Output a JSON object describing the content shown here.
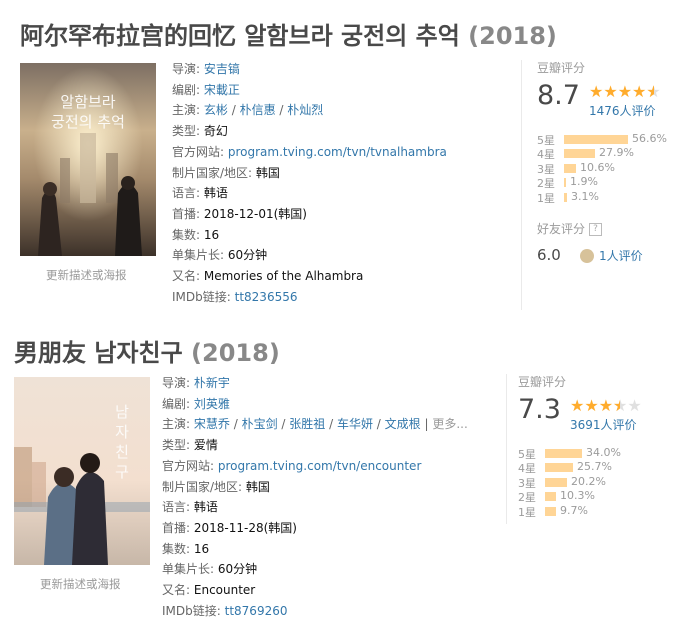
{
  "edit_label": "更新描述或海报",
  "field_labels": {
    "director": "导演:",
    "writer": "编剧:",
    "cast": "主演:",
    "genre": "类型:",
    "site": "官方网站:",
    "country": "制片国家/地区:",
    "language": "语言:",
    "premiere": "首播:",
    "episodes": "集数:",
    "runtime": "单集片长:",
    "aka": "又名:",
    "imdb": "IMDb链接:"
  },
  "rating_header": "豆瓣评分",
  "friend_header": "好友评分",
  "friend_help": "?",
  "star_levels": [
    "5星",
    "4星",
    "3星",
    "2星",
    "1星"
  ],
  "colors": {
    "link": "#3377aa",
    "star": "#ffac2d",
    "bar": "#ffd596",
    "title": "#494949"
  },
  "shows": [
    {
      "title": "阿尔罕布拉宫的回忆 알함브라 궁전의 추억",
      "year": "(2018)",
      "poster_text": [
        "알함브라",
        "궁전의 추억"
      ],
      "director": [
        "安吉镐"
      ],
      "writer": [
        "宋載正"
      ],
      "cast": [
        "玄彬",
        "朴信惠",
        "朴灿烈"
      ],
      "cast_more": "",
      "genre": "奇幻",
      "site": "program.tving.com/tvn/tvnalhambra",
      "country": "韩国",
      "language": "韩语",
      "premiere": "2018-12-01(韩国)",
      "episodes": "16",
      "runtime": "60分钟",
      "aka": "Memories of the Alhambra",
      "imdb": "tt8236556",
      "rating": {
        "score": "8.7",
        "stars": 4.5,
        "votes": "1476人评价",
        "distribution": [
          56.6,
          27.9,
          10.6,
          1.9,
          3.1
        ],
        "distribution_labels": [
          "56.6%",
          "27.9%",
          "10.6%",
          "1.9%",
          "3.1%"
        ]
      },
      "friend": {
        "score": "6.0",
        "votes": "1人评价"
      }
    },
    {
      "title": "男朋友 남자친구",
      "year": "(2018)",
      "poster_text": [
        "남",
        "자",
        "친",
        "구"
      ],
      "director": [
        "朴新宇"
      ],
      "writer": [
        "刘英雅"
      ],
      "cast": [
        "宋慧乔",
        "朴宝剑",
        "张胜祖",
        "车华妍",
        "文成根"
      ],
      "cast_more": "更多...",
      "genre": "爱情",
      "site": "program.tving.com/tvn/encounter",
      "country": "韩国",
      "language": "韩语",
      "premiere": "2018-11-28(韩国)",
      "episodes": "16",
      "runtime": "60分钟",
      "aka": "Encounter",
      "imdb": "tt8769260",
      "rating": {
        "score": "7.3",
        "stars": 3.5,
        "votes": "3691人评价",
        "distribution": [
          34.0,
          25.7,
          20.2,
          10.3,
          9.7
        ],
        "distribution_labels": [
          "34.0%",
          "25.7%",
          "20.2%",
          "10.3%",
          "9.7%"
        ]
      }
    }
  ]
}
